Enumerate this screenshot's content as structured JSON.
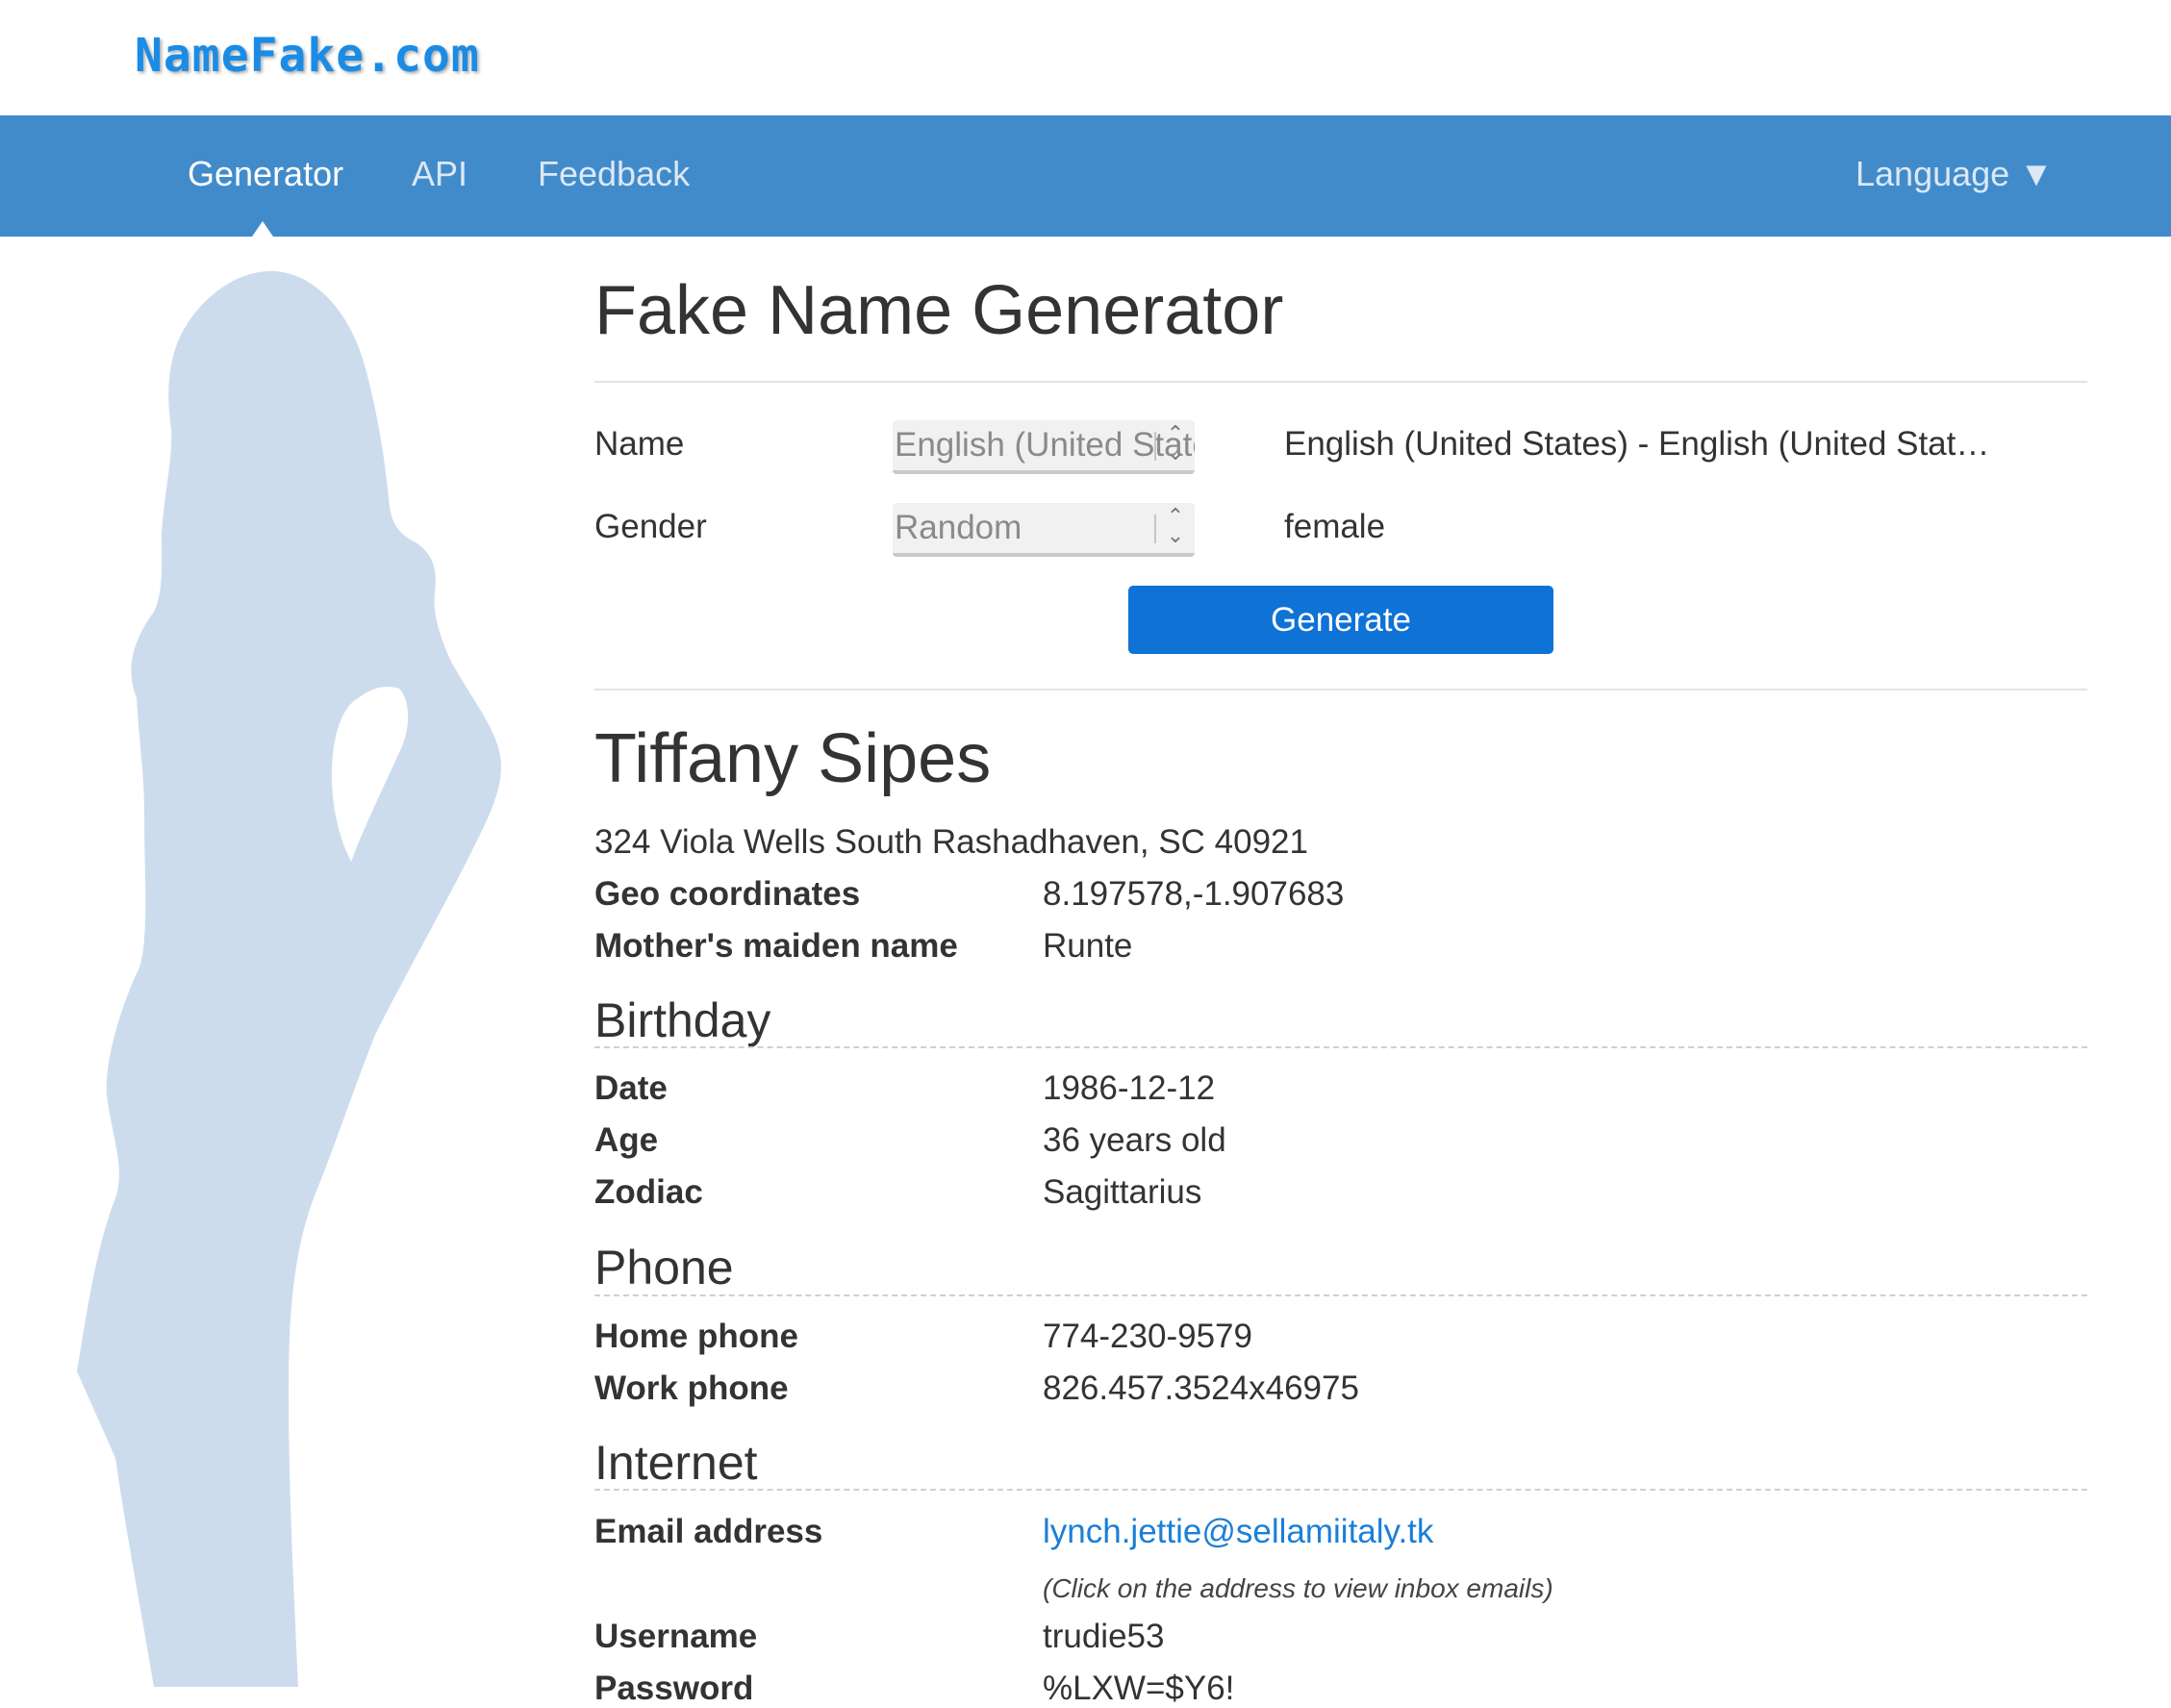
{
  "header": {
    "logo": "NameFake.com"
  },
  "nav": {
    "items": [
      {
        "label": "Generator",
        "active": true
      },
      {
        "label": "API",
        "active": false
      },
      {
        "label": "Feedback",
        "active": false
      }
    ],
    "language": "Language ▼"
  },
  "page": {
    "title": "Fake Name Generator"
  },
  "form": {
    "name_label": "Name",
    "name_select": "English (United States)",
    "name_value": "English (United States) - English (United Stat…",
    "gender_label": "Gender",
    "gender_select": "Random",
    "gender_value": "female",
    "generate_label": "Generate"
  },
  "person": {
    "name": "Tiffany Sipes",
    "address": "324 Viola Wells South Rashadhaven, SC 40921",
    "geo_label": "Geo coordinates",
    "geo_value": "8.197578,-1.907683",
    "maiden_label": "Mother's maiden name",
    "maiden_value": "Runte"
  },
  "birthday": {
    "title": "Birthday",
    "date_label": "Date",
    "date_value": "1986-12-12",
    "age_label": "Age",
    "age_value": "36 years old",
    "zodiac_label": "Zodiac",
    "zodiac_value": "Sagittarius"
  },
  "phone": {
    "title": "Phone",
    "home_label": "Home phone",
    "home_value": "774-230-9579",
    "work_label": "Work phone",
    "work_value": "826.457.3524x46975"
  },
  "internet": {
    "title": "Internet",
    "email_label": "Email address",
    "email_value": "lynch.jettie@sellamiitaly.tk",
    "email_note": "(Click on the address to view inbox emails)",
    "username_label": "Username",
    "username_value": "trudie53",
    "password_label": "Password",
    "password_value": "%LXW=$Y6!"
  },
  "colors": {
    "nav_bg": "#428bca",
    "button_bg": "#0e72d6",
    "link": "#1a7fd8",
    "silhouette": "#cddced",
    "logo": "#1a8ce6"
  },
  "icons": {
    "select_arrows": "up-down-chevron-icon",
    "active_caret": "caret-up-icon",
    "silhouette": "female-silhouette-illustration"
  }
}
